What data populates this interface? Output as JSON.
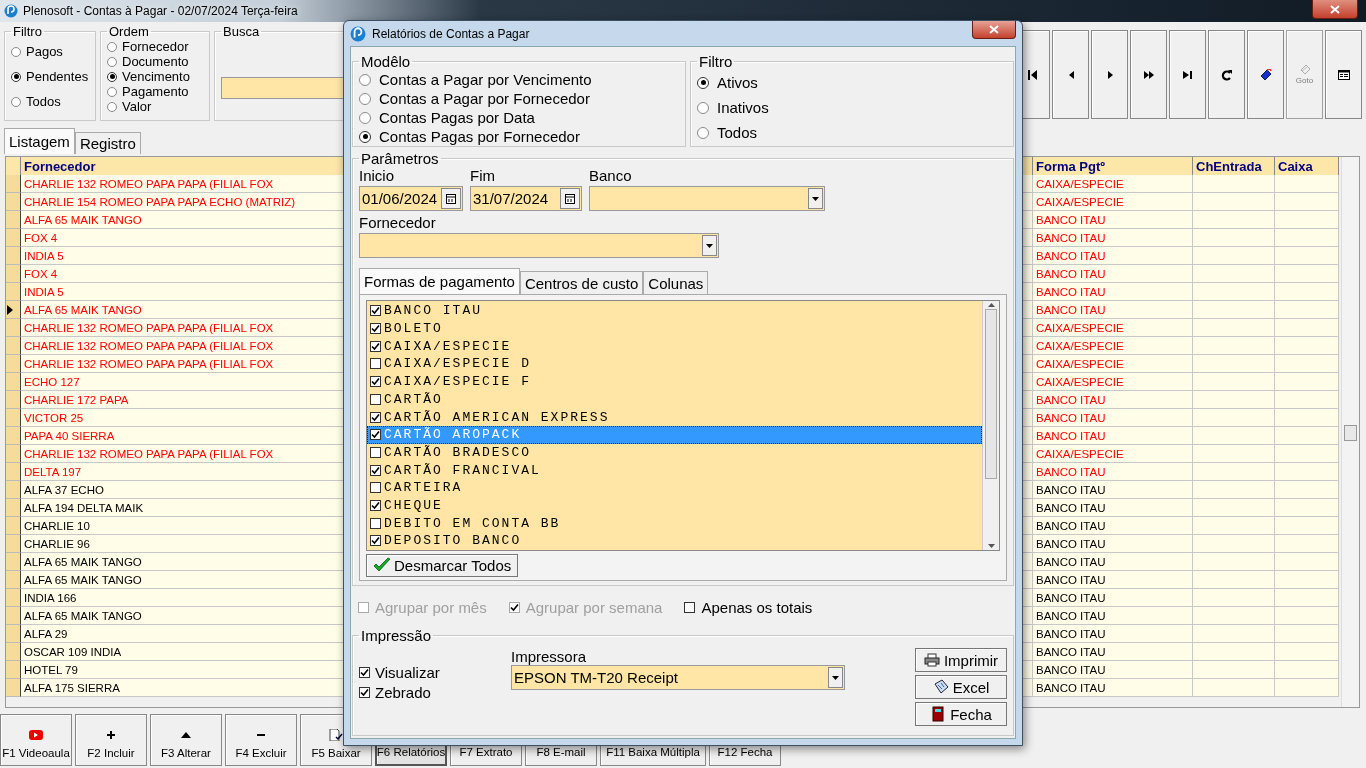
{
  "window": {
    "title": "Plenosoft - Contas à Pagar - 02/07/2024 Terça-feira"
  },
  "filter": {
    "label": "Filtro",
    "options": [
      {
        "label": "Pagos",
        "selected": false
      },
      {
        "label": "Pendentes",
        "selected": true
      },
      {
        "label": "Todos",
        "selected": false
      }
    ]
  },
  "order": {
    "label": "Ordem",
    "options": [
      {
        "label": "Fornecedor",
        "selected": false
      },
      {
        "label": "Documento",
        "selected": false
      },
      {
        "label": "Vencimento",
        "selected": true
      },
      {
        "label": "Pagamento",
        "selected": false
      },
      {
        "label": "Valor",
        "selected": false
      }
    ]
  },
  "search": {
    "label": "Busca"
  },
  "toolbar": [
    {
      "kind": "first",
      "disabled": false
    },
    {
      "kind": "prev",
      "disabled": false
    },
    {
      "kind": "next",
      "disabled": false
    },
    {
      "kind": "skip",
      "disabled": false
    },
    {
      "kind": "last",
      "disabled": false
    },
    {
      "kind": "refresh",
      "disabled": false
    },
    {
      "kind": "book",
      "disabled": false
    },
    {
      "kind": "goto",
      "label": "Goto",
      "disabled": true
    },
    {
      "kind": "form",
      "disabled": false
    }
  ],
  "tabs": [
    {
      "label": "Listagem",
      "selected": true
    },
    {
      "label": "Registro",
      "selected": false
    }
  ],
  "table": {
    "columns": [
      "Fornecedor",
      "Forma Pgtº",
      "ChEntrada",
      "Caixa"
    ],
    "rows": [
      {
        "fornecedor": "CHARLIE 132 ROMEO PAPA PAPA (FILIAL FOX",
        "forma_pgto": "CAIXA/ESPECIE",
        "alert": true,
        "selected": false
      },
      {
        "fornecedor": "CHARLIE 154 ROMEO PAPA PAPA ECHO (MATRIZ)",
        "forma_pgto": "CAIXA/ESPECIE",
        "alert": true,
        "selected": false
      },
      {
        "fornecedor": "ALFA 65 MAIK TANGO",
        "forma_pgto": "BANCO ITAU",
        "alert": true,
        "selected": false
      },
      {
        "fornecedor": "FOX 4",
        "forma_pgto": "BANCO ITAU",
        "alert": true,
        "selected": false
      },
      {
        "fornecedor": "INDIA 5",
        "forma_pgto": "BANCO ITAU",
        "alert": true,
        "selected": false
      },
      {
        "fornecedor": "FOX 4",
        "forma_pgto": "BANCO ITAU",
        "alert": true,
        "selected": false
      },
      {
        "fornecedor": "INDIA 5",
        "forma_pgto": "BANCO ITAU",
        "alert": true,
        "selected": false
      },
      {
        "fornecedor": "ALFA 65 MAIK TANGO",
        "forma_pgto": "BANCO ITAU",
        "alert": true,
        "selected": true
      },
      {
        "fornecedor": "CHARLIE 132 ROMEO PAPA PAPA (FILIAL FOX",
        "forma_pgto": "CAIXA/ESPECIE",
        "alert": true,
        "selected": false
      },
      {
        "fornecedor": "CHARLIE 132 ROMEO PAPA PAPA (FILIAL FOX",
        "forma_pgto": "CAIXA/ESPECIE",
        "alert": true,
        "selected": false
      },
      {
        "fornecedor": "CHARLIE 132 ROMEO PAPA PAPA (FILIAL FOX",
        "forma_pgto": "CAIXA/ESPECIE",
        "alert": true,
        "selected": false
      },
      {
        "fornecedor": "ECHO 127",
        "forma_pgto": "CAIXA/ESPECIE",
        "alert": true,
        "selected": false
      },
      {
        "fornecedor": "CHARLIE 172 PAPA",
        "forma_pgto": "BANCO ITAU",
        "alert": true,
        "selected": false
      },
      {
        "fornecedor": "VICTOR 25",
        "forma_pgto": "BANCO ITAU",
        "alert": true,
        "selected": false
      },
      {
        "fornecedor": "PAPA 40 SIERRA",
        "forma_pgto": "BANCO ITAU",
        "alert": true,
        "selected": false
      },
      {
        "fornecedor": "CHARLIE 132 ROMEO PAPA PAPA (FILIAL FOX",
        "forma_pgto": "CAIXA/ESPECIE",
        "alert": true,
        "selected": false
      },
      {
        "fornecedor": "DELTA 197",
        "forma_pgto": "BANCO ITAU",
        "alert": true,
        "selected": false
      },
      {
        "fornecedor": "ALFA 37 ECHO",
        "forma_pgto": "BANCO ITAU",
        "alert": false,
        "selected": false
      },
      {
        "fornecedor": "ALFA 194 DELTA MAIK",
        "forma_pgto": "BANCO ITAU",
        "alert": false,
        "selected": false
      },
      {
        "fornecedor": "CHARLIE 10",
        "forma_pgto": "BANCO ITAU",
        "alert": false,
        "selected": false
      },
      {
        "fornecedor": "CHARLIE 96",
        "forma_pgto": "BANCO ITAU",
        "alert": false,
        "selected": false
      },
      {
        "fornecedor": "ALFA 65 MAIK TANGO",
        "forma_pgto": "BANCO ITAU",
        "alert": false,
        "selected": false
      },
      {
        "fornecedor": "ALFA 65 MAIK TANGO",
        "forma_pgto": "BANCO ITAU",
        "alert": false,
        "selected": false
      },
      {
        "fornecedor": "INDIA 166",
        "forma_pgto": "BANCO ITAU",
        "alert": false,
        "selected": false
      },
      {
        "fornecedor": "ALFA 65 MAIK TANGO",
        "forma_pgto": "BANCO ITAU",
        "alert": false,
        "selected": false
      },
      {
        "fornecedor": "ALFA 29",
        "forma_pgto": "BANCO ITAU",
        "alert": false,
        "selected": false
      },
      {
        "fornecedor": "OSCAR 109 INDIA",
        "forma_pgto": "BANCO ITAU",
        "alert": false,
        "selected": false
      },
      {
        "fornecedor": "HOTEL 79",
        "forma_pgto": "BANCO ITAU",
        "alert": false,
        "selected": false
      },
      {
        "fornecedor": "ALFA 175 SIERRA",
        "forma_pgto": "BANCO ITAU",
        "alert": false,
        "selected": false
      }
    ]
  },
  "function_keys": [
    {
      "label": "F1 Videoaula",
      "kind": "video",
      "pressed": false
    },
    {
      "label": "F2 Incluir",
      "kind": "add",
      "pressed": false
    },
    {
      "label": "F3 Alterar",
      "kind": "edit",
      "pressed": false
    },
    {
      "label": "F4 Excluir",
      "kind": "delete",
      "pressed": false
    },
    {
      "label": "F5 Baixar",
      "kind": "settle",
      "pressed": false
    },
    {
      "label": "F6 Relatórios",
      "kind": "plain",
      "pressed": true
    },
    {
      "label": "F7 Extrato",
      "kind": "plain",
      "pressed": false
    },
    {
      "label": "F8 E-mail",
      "kind": "plain",
      "pressed": false
    },
    {
      "label": "F11 Baixa Múltipla",
      "kind": "plain",
      "pressed": false
    },
    {
      "label": "F12 Fecha",
      "kind": "plain",
      "pressed": false
    }
  ],
  "dialog": {
    "title": "Relatórios de Contas a Pagar",
    "model": {
      "label": "Modêlo",
      "options": [
        {
          "label": "Contas a Pagar por Vencimento",
          "selected": false
        },
        {
          "label": "Contas a Pagar por Fornecedor",
          "selected": false
        },
        {
          "label": "Contas Pagas por Data",
          "selected": false
        },
        {
          "label": "Contas Pagas por Fornecedor",
          "selected": true
        }
      ]
    },
    "filter": {
      "label": "Filtro",
      "options": [
        {
          "label": "Ativos",
          "selected": true
        },
        {
          "label": "Inativos",
          "selected": false
        },
        {
          "label": "Todos",
          "selected": false
        }
      ]
    },
    "parameters": {
      "label": "Parâmetros",
      "start_label": "Inicio",
      "start_value": "01/06/2024",
      "end_label": "Fim",
      "end_value": "31/07/2024",
      "bank_label": "Banco",
      "supplier_label": "Fornecedor",
      "tabs": [
        {
          "label": "Formas de pagamento",
          "selected": true
        },
        {
          "label": "Centros de custo",
          "selected": false
        },
        {
          "label": "Colunas",
          "selected": false
        }
      ],
      "payment_methods": [
        {
          "label": "BANCO ITAU",
          "checked": true,
          "selected": false
        },
        {
          "label": "BOLETO",
          "checked": true,
          "selected": false
        },
        {
          "label": "CAIXA/ESPECIE",
          "checked": true,
          "selected": false
        },
        {
          "label": "CAIXA/ESPECIE D",
          "checked": false,
          "selected": false
        },
        {
          "label": "CAIXA/ESPECIE F",
          "checked": true,
          "selected": false
        },
        {
          "label": "CARTÃO",
          "checked": false,
          "selected": false
        },
        {
          "label": "CARTÃO AMERICAN EXPRESS",
          "checked": true,
          "selected": false
        },
        {
          "label": "CARTÃO AROPACK",
          "checked": true,
          "selected": true
        },
        {
          "label": "CARTÃO BRADESCO",
          "checked": false,
          "selected": false
        },
        {
          "label": "CARTÃO FRANCIVAL",
          "checked": true,
          "selected": false
        },
        {
          "label": "CARTEIRA",
          "checked": false,
          "selected": false
        },
        {
          "label": "CHEQUE",
          "checked": true,
          "selected": false
        },
        {
          "label": "DEBITO EM CONTA BB",
          "checked": false,
          "selected": false
        },
        {
          "label": "DEPOSITO BANCO",
          "checked": true,
          "selected": false
        }
      ],
      "uncheck_all": "Desmarcar Todos"
    },
    "options": [
      {
        "label": "Agrupar por mês",
        "checked": false,
        "disabled": true
      },
      {
        "label": "Agrupar por semana",
        "checked": true,
        "disabled": true
      },
      {
        "label": "Apenas os totais",
        "checked": false,
        "disabled": false
      }
    ],
    "print": {
      "label": "Impressão",
      "options": [
        {
          "label": "Visualizar",
          "checked": true
        },
        {
          "label": "Zebrado",
          "checked": true
        }
      ],
      "printer_label": "Impressora",
      "printer_value": "EPSON TM-T20 Receipt",
      "buttons": [
        {
          "label": "Imprimir",
          "kind": "print"
        },
        {
          "label": "Excel",
          "kind": "excel"
        },
        {
          "label": "Fecha",
          "kind": "close"
        }
      ]
    }
  }
}
